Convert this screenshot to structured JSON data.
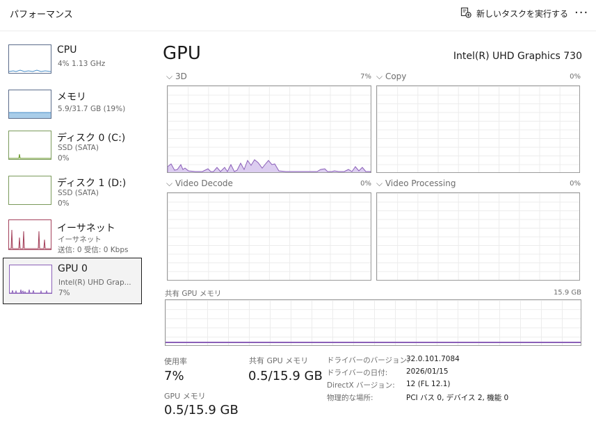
{
  "header": {
    "title": "パフォーマンス",
    "run_task_label": "新しいタスクを実行する",
    "more_label": "···"
  },
  "sidebar": {
    "items": [
      {
        "title": "CPU",
        "sub1": "4%  1.13 GHz",
        "sub2": ""
      },
      {
        "title": "メモリ",
        "sub1": "5.9/31.7 GB (19%)",
        "sub2": ""
      },
      {
        "title": "ディスク 0 (C:)",
        "sub1": "SSD (SATA)",
        "sub2": "0%"
      },
      {
        "title": "ディスク 1 (D:)",
        "sub1": "SSD (SATA)",
        "sub2": "0%"
      },
      {
        "title": "イーサネット",
        "sub1": "イーサネット",
        "sub2": "送信: 0 受信: 0 Kbps"
      },
      {
        "title": "GPU 0",
        "sub1": "Intel(R) UHD Grap...",
        "sub2": "7%"
      }
    ],
    "selected_index": 5
  },
  "gpu": {
    "title": "GPU",
    "model": "Intel(R) UHD Graphics 730"
  },
  "engines": [
    {
      "label": "3D",
      "value": "7%"
    },
    {
      "label": "Copy",
      "value": "0%"
    },
    {
      "label": "Video Decode",
      "value": "0%"
    },
    {
      "label": "Video Processing",
      "value": "0%"
    }
  ],
  "shared_memory_graph": {
    "label": "共有 GPU メモリ",
    "max": "15.9 GB"
  },
  "stats": {
    "usage_label": "使用率",
    "usage_value": "7%",
    "shared_label": "共有 GPU メモリ",
    "shared_value": "0.5/15.9 GB",
    "gpu_mem_label": "GPU メモリ",
    "gpu_mem_value": "0.5/15.9 GB"
  },
  "info": [
    {
      "key": "ドライバーのバージョン:",
      "value": "32.0.101.7084"
    },
    {
      "key": "ドライバーの日付:",
      "value": "2026/01/15"
    },
    {
      "key": "DirectX バージョン:",
      "value": "12 (FL 12.1)"
    },
    {
      "key": "物理的な場所:",
      "value": "PCI バス 0, デバイス 2, 機能 0"
    }
  ],
  "colors": {
    "gpu_accent": "#8a5fb8",
    "gpu_fill": "#dccdf0",
    "cpu_line": "#4a8fc9",
    "memory_fill": "#a9cde9",
    "disk_line": "#6a9a2a",
    "ethernet_line": "#a3405a"
  }
}
